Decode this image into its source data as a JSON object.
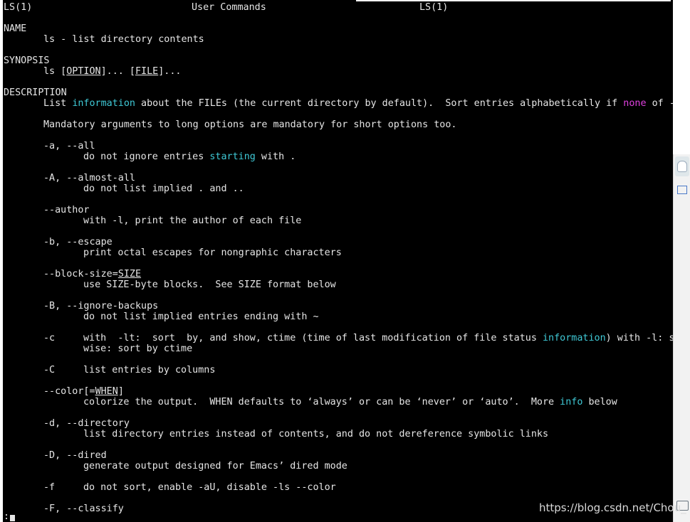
{
  "header": {
    "left": "LS(1)",
    "center": "User Commands",
    "right": "LS(1)"
  },
  "name": {
    "heading": "NAME",
    "text": "ls - list directory contents"
  },
  "synopsis": {
    "heading": "SYNOPSIS",
    "cmd": "ls",
    "option": "OPTION",
    "mid": "]... [",
    "file": "FILE",
    "end": "]..."
  },
  "description": {
    "heading": "DESCRIPTION",
    "line1_a": "List ",
    "line1_hi": "information",
    "line1_b": " about the FILEs (the current directory by default).  Sort entries alphabetically if ",
    "line1_none": "none",
    "line1_c": " of -cftu",
    "line2": "Mandatory arguments to long options are mandatory for short options too."
  },
  "options": {
    "all_flag": "-a, --all",
    "all_desc_a": "do not ignore entries ",
    "all_desc_hi": "starting",
    "all_desc_b": " with .",
    "almost_flag": "-A, --almost-all",
    "almost_desc": "do not list implied . and ..",
    "author_flag": "--author",
    "author_desc": "with -l, print the author of each file",
    "escape_flag": "-b, --escape",
    "escape_desc": "print octal escapes for nongraphic characters",
    "block_flag": "--block-size=",
    "block_size": "SIZE",
    "block_desc": "use SIZE-byte blocks.  See SIZE format below",
    "ignore_flag": "-B, --ignore-backups",
    "ignore_desc": "do not list implied entries ending with ~",
    "c_flag": "-c",
    "c_desc_a": "with  -lt:  sort  by, and show, ctime (time of last modification of file status ",
    "c_desc_hi": "information",
    "c_desc_b": ") with -l: sh",
    "c_desc2": "wise: sort by ctime",
    "C_flag": "-C",
    "C_desc": "list entries by columns",
    "color_flag": "--color[=",
    "color_when": "WHEN",
    "color_end": "]",
    "color_desc_a": "colorize the output.  WHEN defaults to ‘always’ or can be ‘never’ or ‘auto’.  More ",
    "color_desc_hi": "info",
    "color_desc_b": " below",
    "dir_flag": "-d, --directory",
    "dir_desc": "list directory entries instead of contents, and do not dereference symbolic links",
    "dired_flag": "-D, --dired",
    "dired_desc": "generate output designed for Emacs’ dired mode",
    "f_flag": "-f",
    "f_desc": "do not sort, enable -aU, disable -ls --color",
    "F_flag": "-F, --classify"
  },
  "prompt": ":",
  "watermark": "https://blog.csdn.net/Chou_",
  "colors": {
    "background": "#000000",
    "text": "#e6e6e6",
    "highlight": "#3fc9d6",
    "magenta": "#e040e0"
  },
  "side_icons": [
    "chat-icon",
    "table-icon",
    "folder-icon"
  ]
}
